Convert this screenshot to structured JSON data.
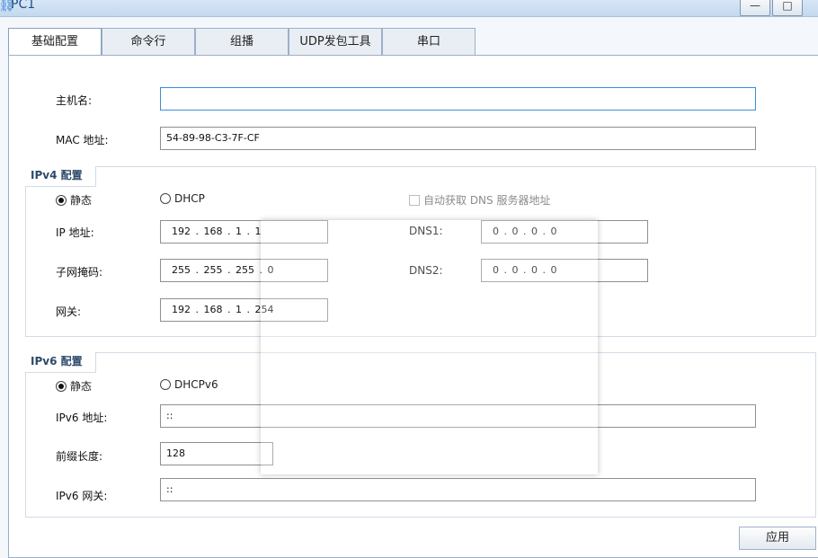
{
  "window": {
    "title": "PC1",
    "minimize_label": "—",
    "maximize_label": "□"
  },
  "tabs": [
    {
      "label": "基础配置"
    },
    {
      "label": "命令行"
    },
    {
      "label": "组播"
    },
    {
      "label": "UDP发包工具"
    },
    {
      "label": "串口"
    }
  ],
  "host": {
    "hostname_label": "主机名:",
    "hostname_value": "",
    "mac_label": "MAC 地址:",
    "mac_value": "54-89-98-C3-7F-CF"
  },
  "ipv4": {
    "section_title": "IPv4 配置",
    "static_label": "静态",
    "dhcp_label": "DHCP",
    "auto_dns_label": "自动获取 DNS 服务器地址",
    "ip_label": "IP 地址:",
    "ip_value": "192 . 168 .  1  .  1",
    "mask_label": "子网掩码:",
    "mask_value": "255 . 255 . 255 .  0",
    "gateway_label": "网关:",
    "gateway_value": "192 . 168 .  1  . 254",
    "dns1_label": "DNS1:",
    "dns1_value": "0  .  0  .  0  .  0",
    "dns2_label": "DNS2:",
    "dns2_value": "0  .  0  .  0  .  0"
  },
  "ipv6": {
    "section_title": "IPv6 配置",
    "static_label": "静态",
    "dhcp_label": "DHCPv6",
    "addr_label": "IPv6 地址:",
    "addr_value": "::",
    "prefix_label": "前缀长度:",
    "prefix_value": "128",
    "gateway_label": "IPv6 网关:",
    "gateway_value": "::"
  },
  "apply_label": "应用"
}
